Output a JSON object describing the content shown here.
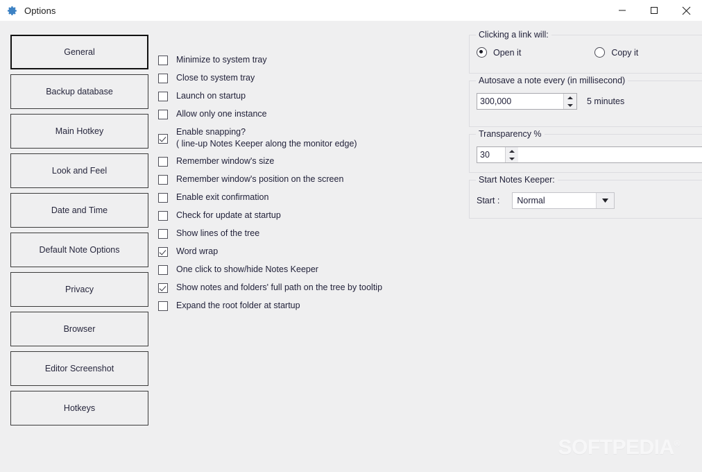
{
  "window": {
    "title": "Options",
    "icon": "gear-icon",
    "titlebar_bg": "#ffffff",
    "content_bg": "#efeff0",
    "controls": [
      {
        "name": "minimize",
        "glyph": "minimize-icon"
      },
      {
        "name": "maximize",
        "glyph": "maximize-icon"
      },
      {
        "name": "close",
        "glyph": "close-icon"
      }
    ]
  },
  "nav": {
    "items": [
      {
        "label": "General",
        "selected": true
      },
      {
        "label": "Backup database",
        "selected": false
      },
      {
        "label": "Main Hotkey",
        "selected": false
      },
      {
        "label": "Look and Feel",
        "selected": false
      },
      {
        "label": "Date and Time",
        "selected": false
      },
      {
        "label": "Default Note Options",
        "selected": false
      },
      {
        "label": "Privacy",
        "selected": false
      },
      {
        "label": "Browser",
        "selected": false
      },
      {
        "label": "Editor Screenshot",
        "selected": false
      },
      {
        "label": "Hotkeys",
        "selected": false
      }
    ]
  },
  "checkboxes": [
    {
      "label": "Minimize to system tray",
      "checked": false,
      "tall": false
    },
    {
      "label": "Close to system tray",
      "checked": false,
      "tall": false
    },
    {
      "label": "Launch on startup",
      "checked": false,
      "tall": false
    },
    {
      "label": "Allow only one instance",
      "checked": false,
      "tall": false
    },
    {
      "label": "Enable snapping?\n( line-up Notes Keeper along the monitor edge)",
      "checked": true,
      "tall": true
    },
    {
      "label": "Remember window's size",
      "checked": false,
      "tall": false
    },
    {
      "label": "Remember window's position on the screen",
      "checked": false,
      "tall": false
    },
    {
      "label": "Enable exit confirmation",
      "checked": false,
      "tall": false
    },
    {
      "label": "Check for update at startup",
      "checked": false,
      "tall": false
    },
    {
      "label": "Show lines of the tree",
      "checked": false,
      "tall": false
    },
    {
      "label": "Word wrap",
      "checked": true,
      "tall": false
    },
    {
      "label": "One click to show/hide Notes Keeper",
      "checked": false,
      "tall": false
    },
    {
      "label": "Show notes and folders' full path on the tree by tooltip",
      "checked": true,
      "tall": false
    },
    {
      "label": "Expand the root folder at startup",
      "checked": false,
      "tall": false
    }
  ],
  "link_group": {
    "title": "Clicking a link will:",
    "options": [
      {
        "label": "Open it",
        "selected": true
      },
      {
        "label": "Copy it",
        "selected": false
      }
    ]
  },
  "autosave_group": {
    "title": "Autosave a note every (in millisecond)",
    "value": "300,000",
    "note": "5 minutes"
  },
  "transparency_group": {
    "title": "Transparency %",
    "value": "30"
  },
  "start_group": {
    "title": "Start Notes Keeper:",
    "label": "Start :",
    "value": "Normal"
  },
  "watermark": {
    "text": "SOFTPEDIA",
    "mark": "®"
  }
}
